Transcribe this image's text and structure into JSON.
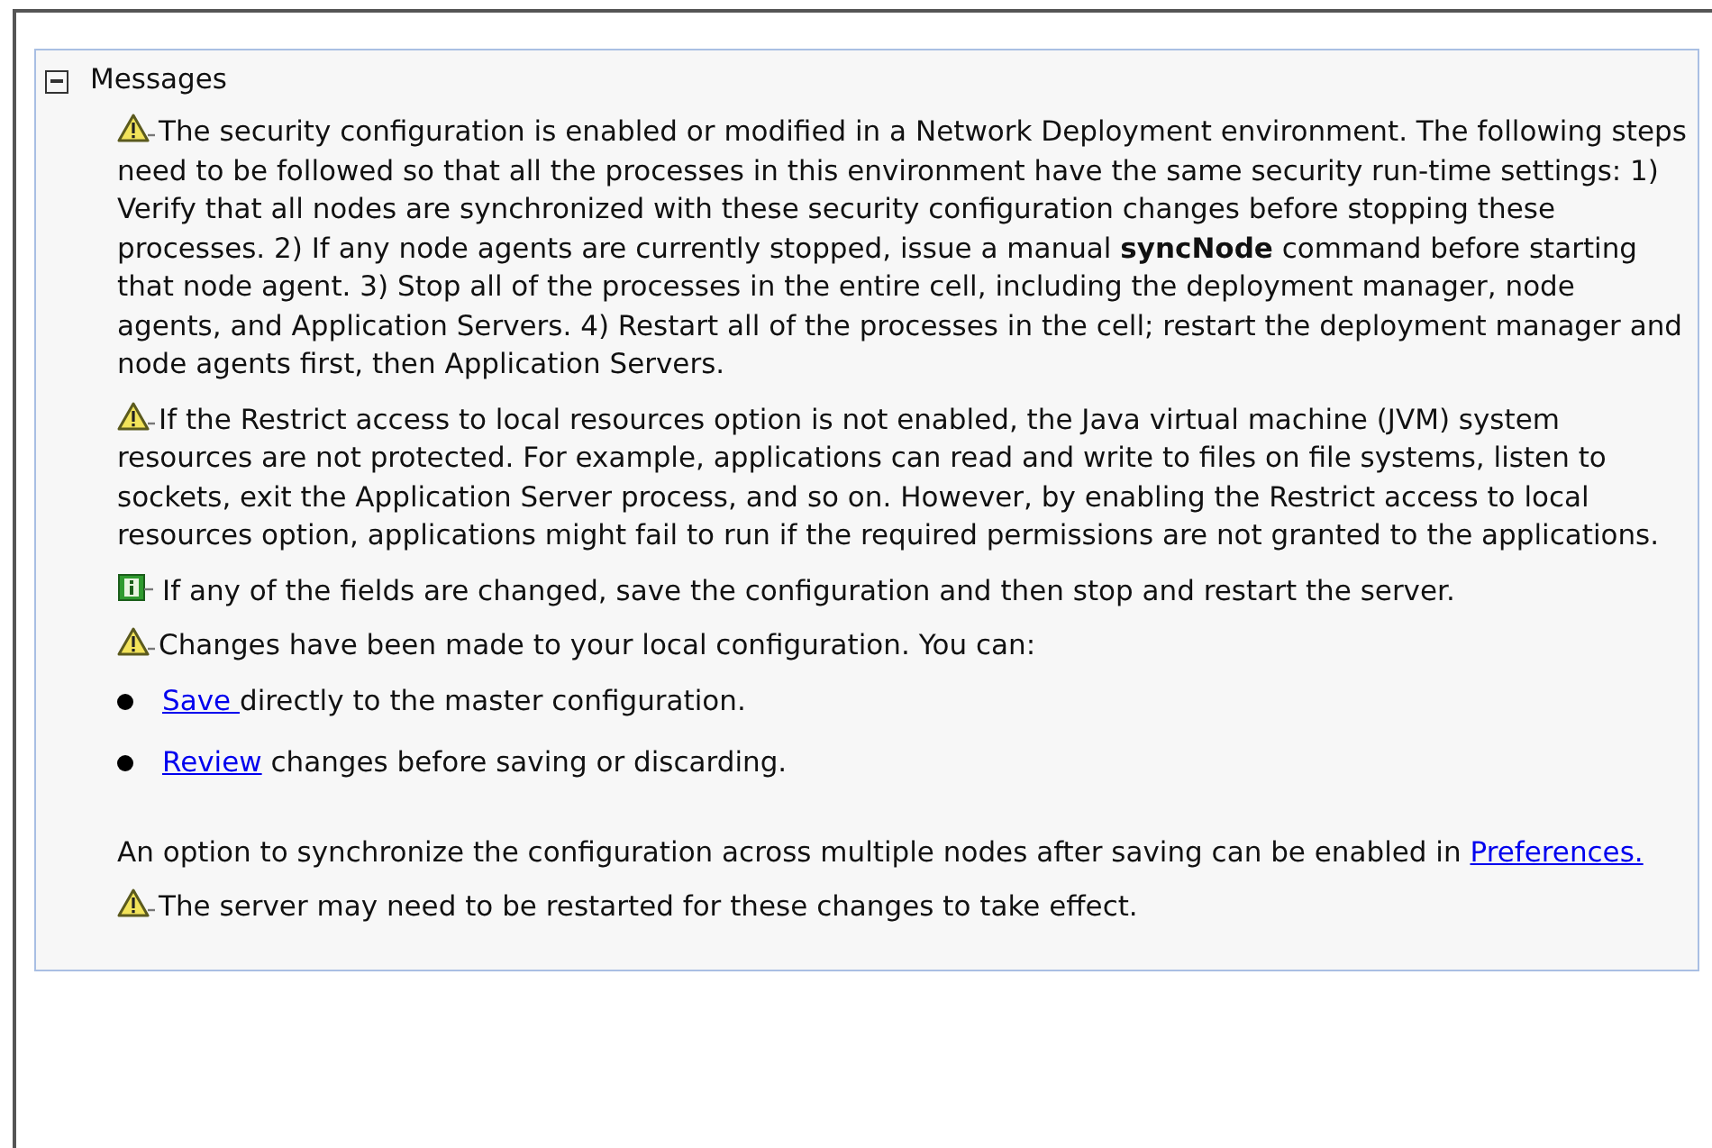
{
  "section": {
    "title": "Messages",
    "expanded": true
  },
  "messages": [
    {
      "kind": "warning",
      "text": "The security configuration is enabled or modified in a Network Deployment environment. The following steps need to be followed so that all the processes in this environment have the same security run-time settings: 1) Verify that all nodes are synchronized with these security configuration changes before stopping these processes. 2) If any node agents are currently stopped, issue a manual **syncNode** command before starting that node agent. 3) Stop all of the processes in the entire cell, including the deployment manager, node agents, and Application Servers. 4) Restart all of the processes in the cell; restart the deployment manager and node agents first, then Application Servers."
    },
    {
      "kind": "warning",
      "text": "If the Restrict access to local resources option is not enabled, the Java virtual machine (JVM) system resources are not protected. For example, applications can read and write to files on file systems, listen to sockets, exit the Application Server process, and so on. However, by enabling the Restrict access to local resources option, applications might fail to run if the required permissions are not granted to the applications."
    },
    {
      "kind": "info",
      "text": "If any of the fields are changed, save the configuration and then stop and restart the server."
    },
    {
      "kind": "warning",
      "text": "Changes have been made to your local configuration. You can:"
    },
    {
      "kind": "bullet",
      "link": "Save ",
      "text": "directly to the master configuration."
    },
    {
      "kind": "bullet",
      "link": "Review",
      "text": " changes before saving or discarding."
    },
    {
      "kind": "note",
      "text": "An option to synchronize the configuration across multiple nodes after saving can be enabled in ",
      "link": "Preferences."
    },
    {
      "kind": "warning",
      "text": "The server may need to be restarted for these changes to take effect."
    }
  ]
}
